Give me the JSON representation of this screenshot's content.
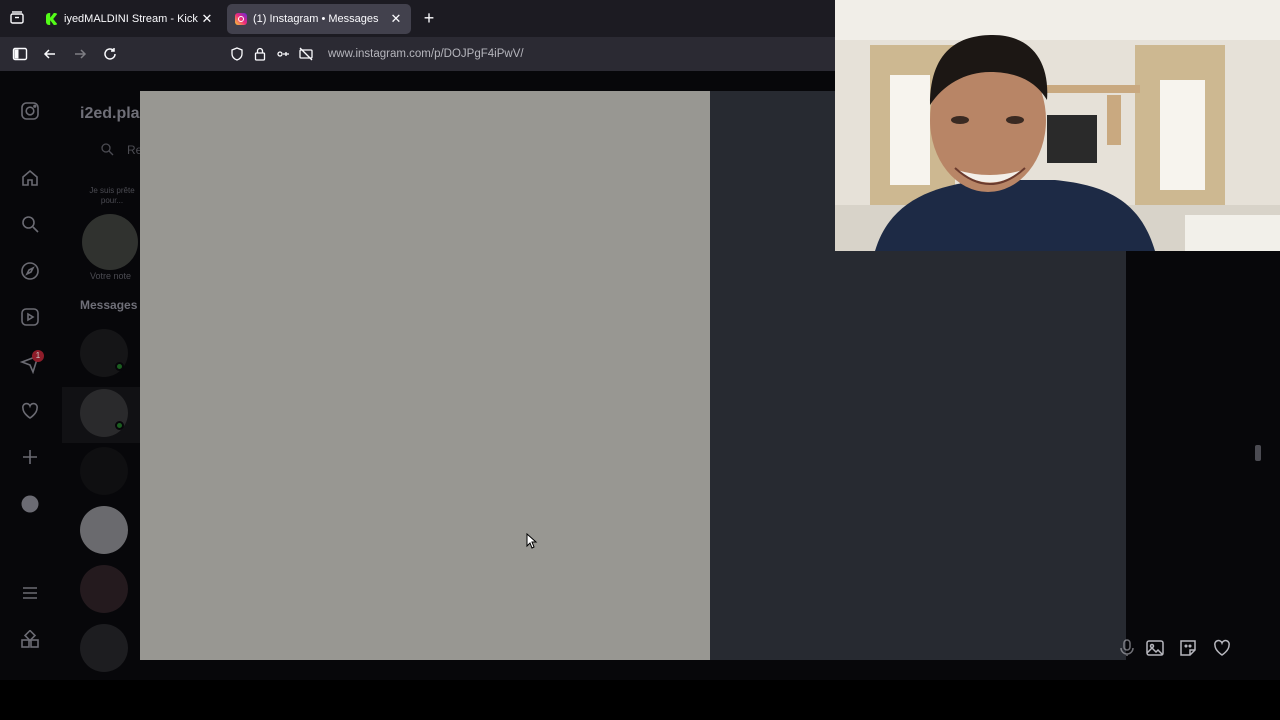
{
  "browser": {
    "tabs": [
      {
        "title": "iyedMALDINI Stream - Kick Da",
        "close": "✕"
      },
      {
        "title": "(1) Instagram • Messages",
        "close": "✕"
      }
    ],
    "new_tab": "+",
    "url": "www.instagram.com/p/DOJPgF4iPwV/"
  },
  "instagram": {
    "username": "i2ed.pla",
    "search_placeholder": "Re",
    "note_text": "Je suis prête pour...",
    "note_label": "Votre note",
    "messages_title": "Messages",
    "notification_count": "1"
  },
  "colors": {
    "post_image": "#989792",
    "post_panel": "#272a31",
    "browser_tabbar": "#1c1b22",
    "browser_navbar": "#2b2a33"
  },
  "icons": {
    "sidebar": [
      "instagram-icon",
      "home-icon",
      "search-icon",
      "explore-icon",
      "reels-icon",
      "messages-icon",
      "heart-icon",
      "create-icon",
      "profile-icon",
      "menu-icon",
      "also-from-meta-icon"
    ],
    "composer": [
      "microphone-icon",
      "image-icon",
      "sticker-icon",
      "heart-icon"
    ]
  },
  "webcam": {
    "description_visible": false
  }
}
